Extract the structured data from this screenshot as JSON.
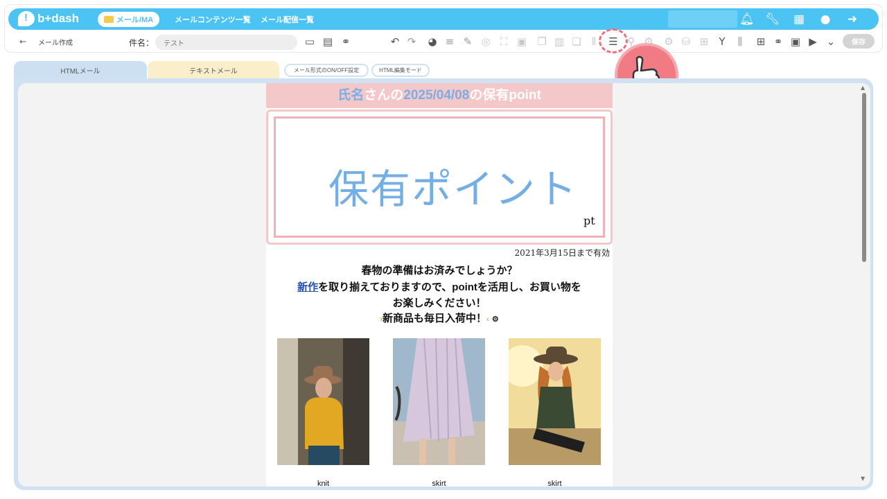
{
  "app": {
    "logo_text": "b+dash",
    "mode_pill": "メール/MA"
  },
  "topnav": {
    "link1": "メールコンテンツ一覧",
    "link2": "メール配信一覧"
  },
  "subbar": {
    "back": "←",
    "title": "メール作成",
    "subject_label": "件名：",
    "subject_value": "テスト",
    "save_label": "保存"
  },
  "tabs": {
    "html": "HTMLメール",
    "text": "テキストメール",
    "format_toggle": "メール形式のON/OFF設定",
    "html_edit": "HTML編集モード"
  },
  "mail": {
    "head_prefix": "氏名",
    "head_mid1": "さんの",
    "head_date": "2025/04/08",
    "head_suffix": "の保有point",
    "point_text": "保有ポイント",
    "point_unit": "pt",
    "valid_until": "2021年3月15日まで有効",
    "line1": "春物の準備はお済みでしょうか？",
    "line2_link": "新作",
    "line2_rest": "を取り揃えておりますので、pointを活用し、お買い物を",
    "line3": "お楽しみください！",
    "line4": "新商品も毎日入荷中！",
    "products": [
      {
        "caption": "knit"
      },
      {
        "caption": "skirt"
      },
      {
        "caption": "skirt"
      }
    ]
  },
  "colors": {
    "topbar": "#4cc4f3",
    "header_pink": "#f4c8c9",
    "accent_blue": "#73aee5",
    "highlight": "#ee6f7d"
  }
}
